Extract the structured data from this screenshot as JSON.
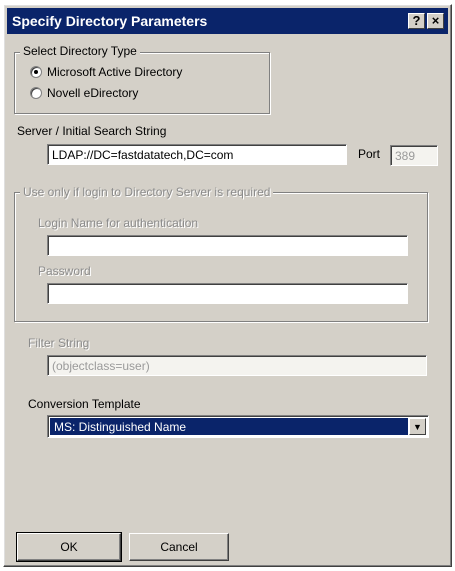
{
  "window": {
    "title": "Specify Directory Parameters",
    "help_button": "?",
    "close_button": "×"
  },
  "directory_type": {
    "group_label": "Select Directory Type",
    "options": [
      {
        "label": "Microsoft Active Directory",
        "selected": true
      },
      {
        "label": "Novell eDirectory",
        "selected": false
      }
    ]
  },
  "server": {
    "label": "Server / Initial Search String",
    "value": "LDAP://DC=fastdatatech,DC=com",
    "port_label": "Port",
    "port_value": "389"
  },
  "login_group": {
    "label": "Use only if login to Directory Server is required",
    "login_name_label": "Login Name for authentication",
    "login_name_value": "",
    "password_label": "Password",
    "password_value": ""
  },
  "filter": {
    "label": "Filter String",
    "value": "(objectclass=user)"
  },
  "conversion": {
    "label": "Conversion Template",
    "selected": "MS: Distinguished Name"
  },
  "buttons": {
    "ok": "OK",
    "cancel": "Cancel"
  }
}
